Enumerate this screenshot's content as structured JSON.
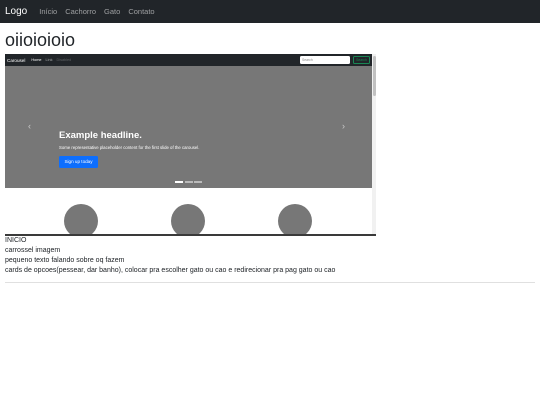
{
  "navbar": {
    "brand": "Logo",
    "links": [
      "Início",
      "Cachorro",
      "Gato",
      "Contato"
    ]
  },
  "page": {
    "title": "oiioioioio"
  },
  "preview": {
    "brand": "Carousel",
    "links": {
      "home": "Home",
      "link": "Link",
      "disabled": "Disabled"
    },
    "search_placeholder": "Search",
    "search_button": "Search",
    "carousel": {
      "headline": "Example headline.",
      "text": "Some representative placeholder content for the first slide of the carousel.",
      "button": "Sign up today",
      "slides": 3,
      "active_slide": 1
    }
  },
  "notes": [
    "INICIO",
    "carrossel imagem",
    "pequeno texto falando sobre oq fazem",
    "cards de opcoes(pessear, dar banho), colocar pra escolher gato ou cao e redirecionar pra pag gato ou cao"
  ],
  "colors": {
    "navbar": "#212529",
    "carousel_bg": "#777777",
    "primary": "#0d6efd",
    "success": "#198754"
  }
}
